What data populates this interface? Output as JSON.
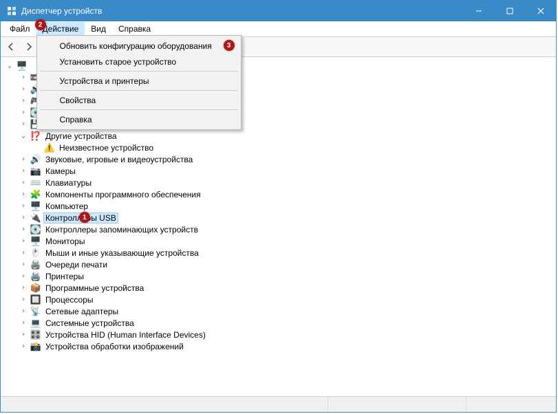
{
  "window": {
    "title": "Диспетчер устройств"
  },
  "badges": {
    "action_menu": "2",
    "refresh_hw": "3",
    "usb_controllers": "1"
  },
  "menubar": {
    "file": "Файл",
    "action": "Действие",
    "view": "Вид",
    "help": "Справка"
  },
  "dropdown": {
    "scan_hw": "Обновить конфигурацию оборудования",
    "add_legacy": "Установить старое устройство",
    "devices_printers": "Устройства и принтеры",
    "properties": "Свойства",
    "help": "Справка"
  },
  "tree": {
    "other_devices": "Другие устройства",
    "unknown_device": "Неизвестное устройство",
    "audio": "Звуковые, игровые и видеоустройства",
    "cameras": "Камеры",
    "keyboards": "Клавиатуры",
    "software_components": "Компоненты программного обеспечения",
    "computer": "Компьютер",
    "usb_controllers": "Контроллеры USB",
    "storage_controllers": "Контроллеры запоминающих устройств",
    "monitors": "Мониторы",
    "mice": "Мыши и иные указывающие устройства",
    "print_queues": "Очереди печати",
    "printers": "Принтеры",
    "software_devices": "Программные устройства",
    "processors": "Процессоры",
    "network_adapters": "Сетевые адаптеры",
    "system_devices": "Системные устройства",
    "hid": "Устройства HID (Human Interface Devices)",
    "imaging": "Устройства обработки изображений"
  }
}
